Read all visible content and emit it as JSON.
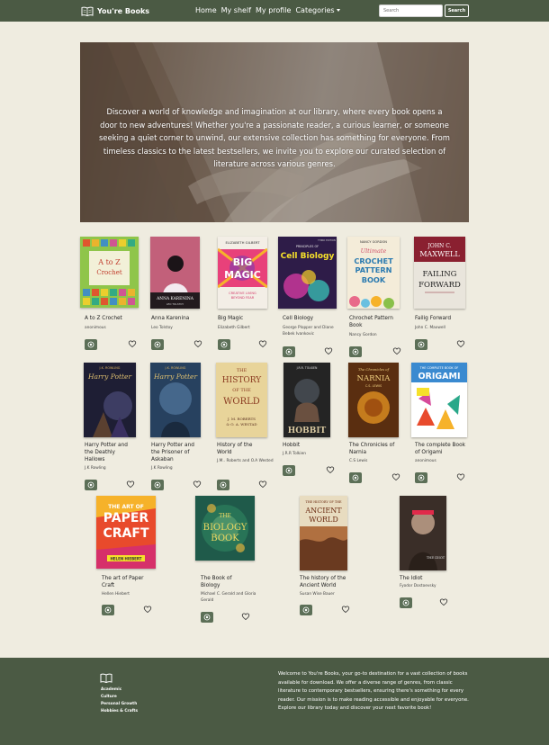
{
  "nav": {
    "brand": "You're Books",
    "links": [
      "Home",
      "My shelf",
      "My profile",
      "Categories"
    ],
    "search_placeholder": "Search",
    "search_button": "Search"
  },
  "hero": {
    "text": "Discover a world of knowledge and imagination at our library, where every book opens a door to new adventures! Whether you're a passionate reader, a curious learner, or someone seeking a quiet corner to unwind, our extensive collection has something for everyone. From timeless classics to the latest bestsellers, we invite you to explore our curated selection of literature across various genres."
  },
  "books": [
    {
      "title": "A to Z Crochet",
      "author": "anonimous",
      "cover_text": [
        "A to Z",
        "Crochet"
      ],
      "cover_color": "#8fc54a"
    },
    {
      "title": "Anna Karenina",
      "author": "Leo Tolstoy",
      "cover_text": [
        "ANNA KARENINA",
        "LEO TOLSTOY"
      ],
      "cover_color": "#c2607a"
    },
    {
      "title": "Big Magic",
      "author": "Elizabeth Gilbert",
      "cover_text": [
        "ELIZABETH GILBERT",
        "BIG",
        "MAGIC",
        "CREATIVE LIVING",
        "BEYOND FEAR"
      ],
      "cover_color": "#f3eee6"
    },
    {
      "title": "Cell Biology",
      "author": "George Plopper and Diane Bebek Ivankovic",
      "cover_text": [
        "PRINCIPLES OF",
        "Cell Biology",
        "THIRD EDITION"
      ],
      "cover_color": "#3a2a5a"
    },
    {
      "title": "Chrochet Pattern Book",
      "author": "Nancy Gordon",
      "cover_text": [
        "NANCY GORDON",
        "Ultimate",
        "CROCHET",
        "PATTERN",
        "BOOK"
      ],
      "cover_color": "#f4ecd9"
    },
    {
      "title": "Failig Forward",
      "author": "John C. Maxwell",
      "cover_text": [
        "JOHN C.",
        "MAXWELL",
        "FAILING",
        "FORWARD"
      ],
      "cover_color": "#e9e5dc"
    },
    {
      "title": "Harry Potter and the Deathly Hallows",
      "author": "J.K Rowling",
      "cover_text": [
        "J.K. ROWLING",
        "Harry Potter"
      ],
      "cover_color": "#2a2a40"
    },
    {
      "title": "Harry Potter and the Prisoner of Askaban",
      "author": "J.K Rowling",
      "cover_text": [
        "J.K. ROWLING",
        "Harry Potter"
      ],
      "cover_color": "#27415f"
    },
    {
      "title": "History of the World",
      "author": "J.M.. Roberts and O.A Wested",
      "cover_text": [
        "THE",
        "HISTORY",
        "OF THE",
        "WORLD",
        "J. M. ROBERTS",
        "& O. A. WESTAD"
      ],
      "cover_color": "#e8d49a"
    },
    {
      "title": "Hobbit",
      "author": "J.R.R Tolkien",
      "cover_text": [
        "J.R.R. TOLKIEN",
        "HOBBIT"
      ],
      "cover_color": "#2a2a2a"
    },
    {
      "title": "The Chronicles of Narnia",
      "author": "C.S Lewis",
      "cover_text": [
        "The Chronicles of",
        "NARNIA",
        "C.S. LEWIS"
      ],
      "cover_color": "#6a3a18"
    },
    {
      "title": "The complete Book of Origami",
      "author": "anonimous",
      "cover_text": [
        "THE COMPLETE BOOK OF",
        "ORIGAMI"
      ],
      "cover_color": "#ffffff"
    },
    {
      "title": "The art of Paper Craft",
      "author": "Hellen Hiebert",
      "cover_text": [
        "THE ART OF",
        "PAPER",
        "CRAFT",
        "HELEN HIEBERT"
      ],
      "cover_color": "#e84a2c"
    },
    {
      "title": "The Book of Biology",
      "author": "Michael C. Gerald and Gloria Gerald",
      "cover_text": [
        "THE",
        "BIOLOGY",
        "BOOK"
      ],
      "cover_color": "#1f5a4a"
    },
    {
      "title": "The history of the Ancient World",
      "author": "Susan Wise Bauer",
      "cover_text": [
        "THE HISTORY OF THE",
        "ANCIENT",
        "WORLD"
      ],
      "cover_color": "#b07040"
    },
    {
      "title": "The Idiot",
      "author": "Fyodor Dostoevsky",
      "cover_text": [
        "THE IDIOT"
      ],
      "cover_color": "#3a2e28"
    }
  ],
  "footer": {
    "categories": [
      "Academic",
      "Culture",
      "Personal Growth",
      "Hobbies & Crafts"
    ],
    "about": "Welcome to You're Books, your go-to destination for a vast collection of books available for download. We offer a diverse range of genres, from classic literature to contemporary bestsellers, ensuring there's something for every reader. Our mission is to make reading accessible and enjoyable for everyone. Explore our library today and discover your next favorite book!"
  },
  "colors": {
    "primary": "#4b5a44",
    "background": "#efece0",
    "button": "#5c6f57"
  },
  "icons": {
    "brand": "book-icon",
    "view": "eye-icon",
    "favorite": "heart-icon"
  }
}
